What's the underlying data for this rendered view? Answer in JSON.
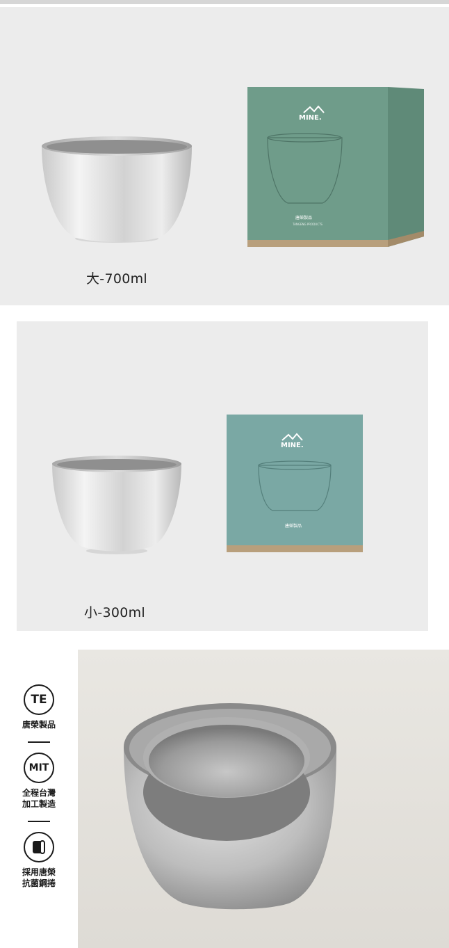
{
  "sections": {
    "large": {
      "size_label": "大-700ml",
      "box_brand": "MINE.",
      "box_maker": "唐榮製品",
      "box_maker_en": "TANGENG PRODUCTS"
    },
    "small": {
      "size_label": "小-300ml",
      "box_brand": "MINE.",
      "box_maker": "唐榮製品"
    }
  },
  "badges": [
    {
      "icon": "te-logo-icon",
      "icon_text": "TE",
      "lines": [
        "唐榮製品"
      ]
    },
    {
      "icon": "mit-logo-icon",
      "icon_text": "MIT",
      "lines": [
        "全程台灣",
        "加工製造"
      ]
    },
    {
      "icon": "steel-coil-icon",
      "icon_text": "",
      "lines": [
        "採用唐榮",
        "抗菌鋼捲"
      ]
    }
  ],
  "colors": {
    "box_large": "#6f9c8a",
    "box_small": "#7aa8a4",
    "panel_bg": "#ececec"
  }
}
